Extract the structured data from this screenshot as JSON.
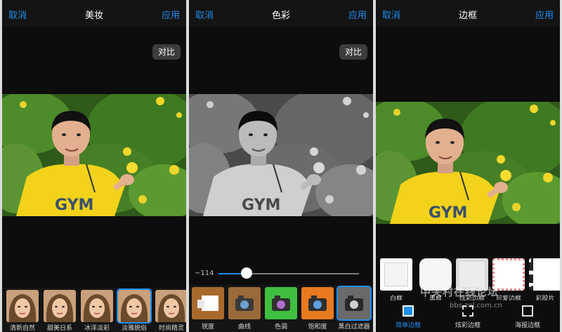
{
  "panel1": {
    "cancel": "取消",
    "title": "美妆",
    "apply": "应用",
    "compare": "对比",
    "filters": [
      {
        "label": "清新自然"
      },
      {
        "label": "甜美日系"
      },
      {
        "label": "冰洋淡彩"
      },
      {
        "label": "淡雅脱俗",
        "selected": true
      },
      {
        "label": "时尚精灵"
      }
    ]
  },
  "panel2": {
    "cancel": "取消",
    "title": "色彩",
    "apply": "应用",
    "compare": "对比",
    "slider": {
      "value_text": "−114",
      "level_fraction": 0.2
    },
    "tools": [
      {
        "label": "锐度"
      },
      {
        "label": "曲线"
      },
      {
        "label": "色调"
      },
      {
        "label": "饱和度"
      },
      {
        "label": "黑白过滤器",
        "selected": true
      }
    ]
  },
  "panel3": {
    "cancel": "取消",
    "title": "边框",
    "apply": "应用",
    "frames": [
      {
        "label": "白框"
      },
      {
        "label": "黑框"
      },
      {
        "label": "炫彩边框"
      },
      {
        "label": "可爱边框"
      },
      {
        "label": "彩胶片"
      }
    ],
    "tabs": [
      {
        "label": "简单边框",
        "active": true,
        "icon": "square-frame-icon"
      },
      {
        "label": "炫彩边框",
        "icon": "dashed-frame-icon"
      },
      {
        "label": "海报边框",
        "icon": "poster-frame-icon"
      }
    ]
  },
  "watermark": {
    "text": "中关村在线论坛",
    "url": "bbs.zol.com.cn"
  },
  "colors": {
    "accent": "#1e8ef0",
    "background": "#0d0d0d",
    "shirt": "#f2d21a",
    "foliage": "#3f7a22"
  }
}
